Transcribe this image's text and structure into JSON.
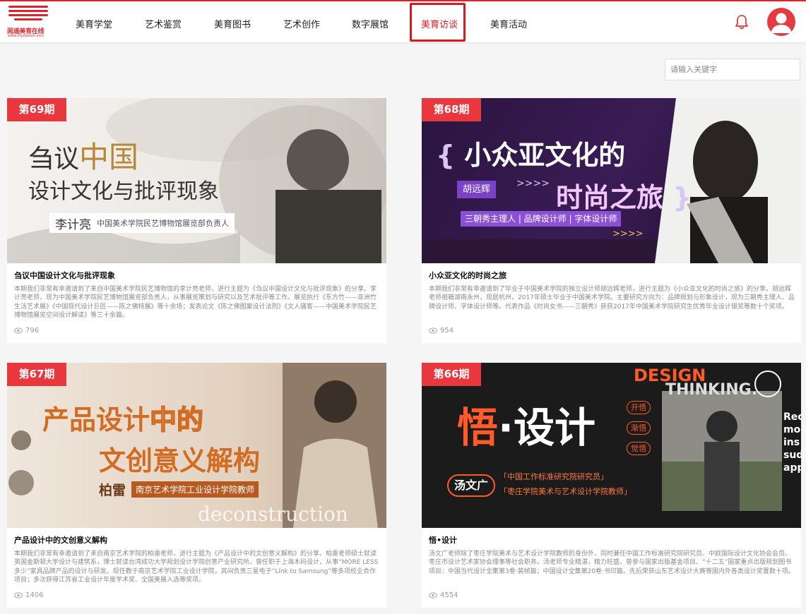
{
  "brand": {
    "name_cn": "阅遥美育在线",
    "name_en": "www.myzaixian.com"
  },
  "nav": {
    "items": [
      {
        "label": "美育学堂"
      },
      {
        "label": "艺术鉴赏"
      },
      {
        "label": "美育图书"
      },
      {
        "label": "艺术创作"
      },
      {
        "label": "数字展馆"
      },
      {
        "label": "美育访谈"
      },
      {
        "label": "美育活动"
      }
    ],
    "active_index": 5
  },
  "search": {
    "placeholder": "请输入关键字"
  },
  "colors": {
    "accent": "#e0181e",
    "badge": "#e8383d"
  },
  "cards": [
    {
      "issue": "第69期",
      "title": "刍议中国设计文化与批评现象",
      "description": "本期我们非常有幸邀请到了来自中国美术学院民艺博物馆的李计亮老师，进行主题为《刍议中国设计文化与批评现象》的分享。李计亮老师，现为中国美术学院民艺博物馆展览部负责人，从事展览策划与研究以及艺术批评等工作。展览执行《东方竹——亚洲竹生活艺术展》《中国现代设计巨匠——陈之佛特展》等十余场；发表论文《陈之佛图案设计法则》《文人骚客——中国美术学院民艺博物馆展览空间设计解读》等三十余篇。",
      "views": "796",
      "cover": {
        "line1a": "刍议",
        "line1b": "中国",
        "line2": "设计文化与批评现象",
        "person": "李计亮",
        "role": "中国美术学院民艺博物馆展览部负责人"
      }
    },
    {
      "issue": "第68期",
      "title": "小众亚文化的时尚之旅",
      "description": "本期我们非常有幸邀请到了毕业于中国美术学院的独立设计师胡远辉老师，进行主题为《小众亚文化的时尚之旅》的分享。胡远辉老师祖籍湖南永州，现居杭州，2017年硕士毕业于中国美术学院。主要研究方向为：品牌规划与形象设计，现为三朝秀主理人、品牌设计师、字体设计师等。代表作品《时尚女书——三朝秀》获获2017年中国美术学院研究生优秀毕业设计银奖等数十个奖项。",
      "views": "954",
      "cover": {
        "line1": "小众亚文化的",
        "line2": "时尚之旅",
        "person": "胡远辉",
        "arrows": ">>>>",
        "roles": "三朝秀主理人 | 品牌设计师 | 字体设计师",
        "arrows2": ">>>>"
      }
    },
    {
      "issue": "第67期",
      "title": "产品设计中的文创意义解构",
      "description": "本期我们非常有幸邀请到了来自南京艺术学院的柏雷老师，进行主题为《产品设计中的文创意义解构》的分享。柏雷老师硕士就读英国金斯顿大学设计与建筑系，博士就读台湾成功大学规划设计学院创意产业研究所。曾任职于上海木码设计，从事“MORE LESS多少”家具品牌产品的设计与研发。现任教于南京艺术学院工业设计学院，其间负责三星电子“Link to Samsung”等多项校企合作项目；多次获得江苏省工业设计年度学术奖、全国美展入选等奖项。",
      "views": "1406",
      "cover": {
        "line1a": "产品设计",
        "line1b": "中的",
        "line2": "文创意义解构",
        "person": "柏雷",
        "role": "南京艺术学院工业设计学院教师",
        "en": "deconstruction"
      }
    },
    {
      "issue": "第66期",
      "title": "悟•设计",
      "description": "汤文广老师除了枣庄学院美术与艺术设计学院教师的身份外，同时兼任中国工作标准研究院研究员、中欧国际设计文化协会会员、枣庄市设计艺术家协会理事等社会职务。汤老师专业精湛，精力旺盛，曾参与国家出版基金项目、“十二五”国家重点出版规划图书项目：中国当代设计全集第3卷·装帧篇；中国设计全集第20卷·书印篇。先后荣获山东艺术设计大赛等国内外各类设计奖置数十项。",
      "views": "4554",
      "cover": {
        "word": "DESIGN",
        "word2": "THINKING.",
        "title_a": "悟",
        "title_b": "·设计",
        "tag1": "开悟",
        "tag2": "渐悟",
        "tag3": "觉悟",
        "person": "汤文广",
        "role1": "「中国工作标准研究院研究员」",
        "role2": "「枣庄学院美术与艺术设计学院教师」",
        "side": "Rec mo ins sud app"
      }
    }
  ]
}
